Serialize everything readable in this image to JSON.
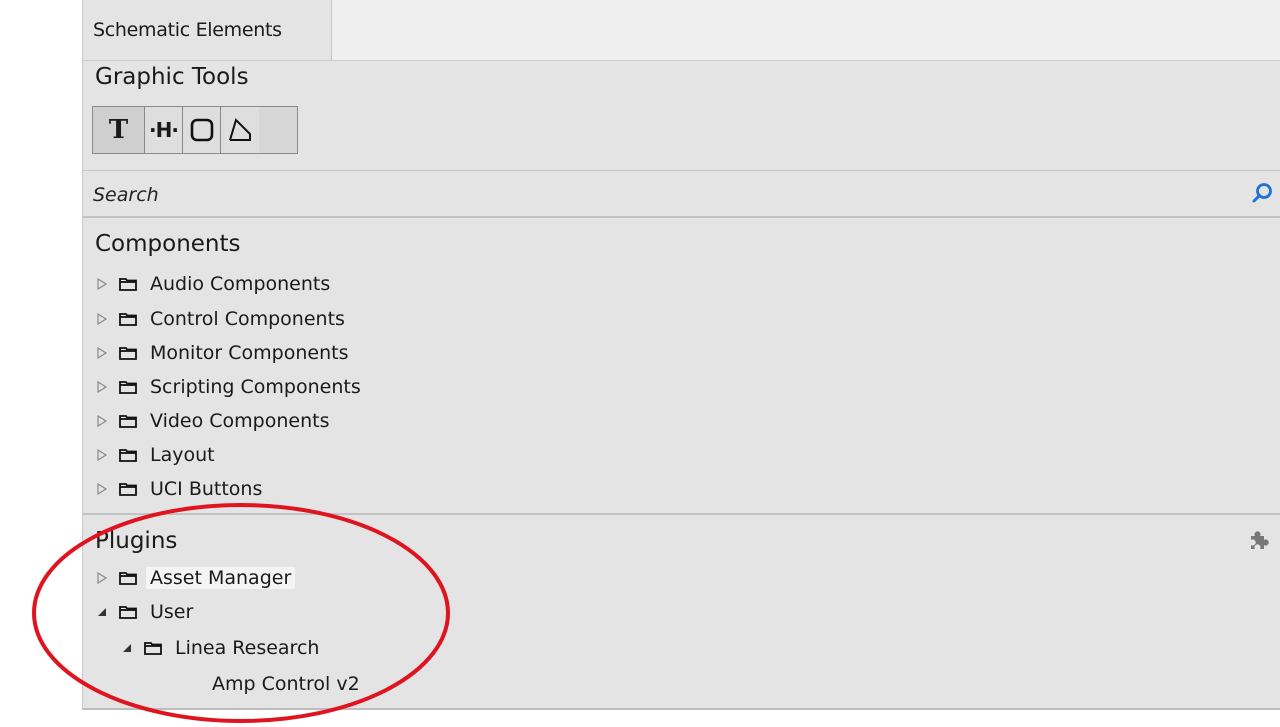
{
  "tab": {
    "label": "Schematic Elements"
  },
  "graphic_tools": {
    "title": "Graphic Tools",
    "tools": [
      {
        "name": "text-tool-icon",
        "glyph": "T"
      },
      {
        "name": "line-tool-icon",
        "glyph": "·H·"
      },
      {
        "name": "rectangle-tool-icon",
        "glyph": ""
      },
      {
        "name": "polygon-tool-icon",
        "glyph": ""
      }
    ]
  },
  "search": {
    "placeholder": "Search",
    "value": ""
  },
  "components": {
    "title": "Components",
    "items": [
      {
        "label": "Audio Components"
      },
      {
        "label": "Control Components"
      },
      {
        "label": "Monitor Components"
      },
      {
        "label": "Scripting Components"
      },
      {
        "label": "Video Components"
      },
      {
        "label": "Layout"
      },
      {
        "label": "UCI Buttons"
      }
    ]
  },
  "plugins": {
    "title": "Plugins",
    "items": [
      {
        "label": "Asset Manager",
        "expanded": false
      },
      {
        "label": "User",
        "expanded": true
      },
      {
        "label": "Linea Research",
        "expanded": true
      },
      {
        "label": "Amp Control v2"
      }
    ]
  },
  "colors": {
    "accent": "#1e73d6",
    "annotation": "#e0141e",
    "panel": "#e4e4e4"
  }
}
